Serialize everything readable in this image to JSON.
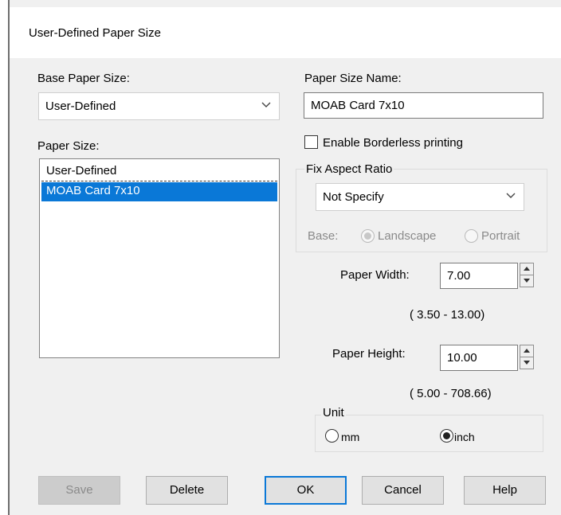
{
  "dialog": {
    "title": "User-Defined Paper Size"
  },
  "base_paper_size": {
    "label": "Base Paper Size:",
    "value": "User-Defined"
  },
  "paper_size_name": {
    "label": "Paper Size Name:",
    "value": "MOAB Card 7x10"
  },
  "paper_size": {
    "label": "Paper Size:",
    "items": [
      "User-Defined",
      "MOAB Card 7x10"
    ],
    "selected": "MOAB Card 7x10"
  },
  "borderless": {
    "label": "Enable Borderless printing",
    "checked": false
  },
  "aspect_ratio": {
    "group_label": "Fix Aspect Ratio",
    "value": "Not Specify",
    "base_label": "Base:",
    "landscape_label": "Landscape",
    "portrait_label": "Portrait",
    "selected": "Landscape",
    "enabled": false
  },
  "paper_width": {
    "label": "Paper Width:",
    "value": "7.00",
    "range": "( 3.50 - 13.00)"
  },
  "paper_height": {
    "label": "Paper Height:",
    "value": "10.00",
    "range": "( 5.00 - 708.66)"
  },
  "unit": {
    "group_label": "Unit",
    "mm_label": "mm",
    "inch_label": "inch",
    "selected": "inch"
  },
  "buttons": {
    "save": "Save",
    "delete": "Delete",
    "ok": "OK",
    "cancel": "Cancel",
    "help": "Help"
  },
  "colors": {
    "selection": "#0a78d7",
    "dialog_bg": "#f0f0f0",
    "disabled_text": "#8a8a8a"
  }
}
